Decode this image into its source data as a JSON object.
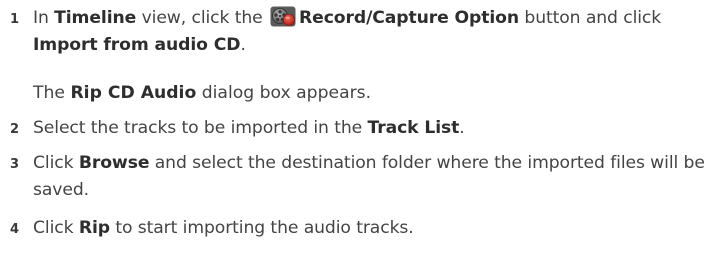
{
  "steps": [
    {
      "number": "1",
      "pre1": "In ",
      "b1": "Timeline",
      "mid1": " view, click the ",
      "icon": "film-reel-record-icon",
      "b2": "Record/Capture Option",
      "mid2": " button and click ",
      "b3": "Import from audio CD",
      "end": ".",
      "note_pre": "The ",
      "note_bold": "Rip CD Audio",
      "note_post": " dialog box appears."
    },
    {
      "number": "2",
      "pre": "Select the tracks to be imported in the ",
      "bold": "Track List",
      "post": "."
    },
    {
      "number": "3",
      "pre": "Click ",
      "bold": "Browse",
      "post": " and select the destination folder where the imported files will be saved."
    },
    {
      "number": "4",
      "pre": "Click ",
      "bold": "Rip",
      "post": " to start importing the audio tracks."
    }
  ],
  "colors": {
    "text": "#444444",
    "icon_gray": "#6f6f6f",
    "icon_red": "#d42b1e"
  }
}
